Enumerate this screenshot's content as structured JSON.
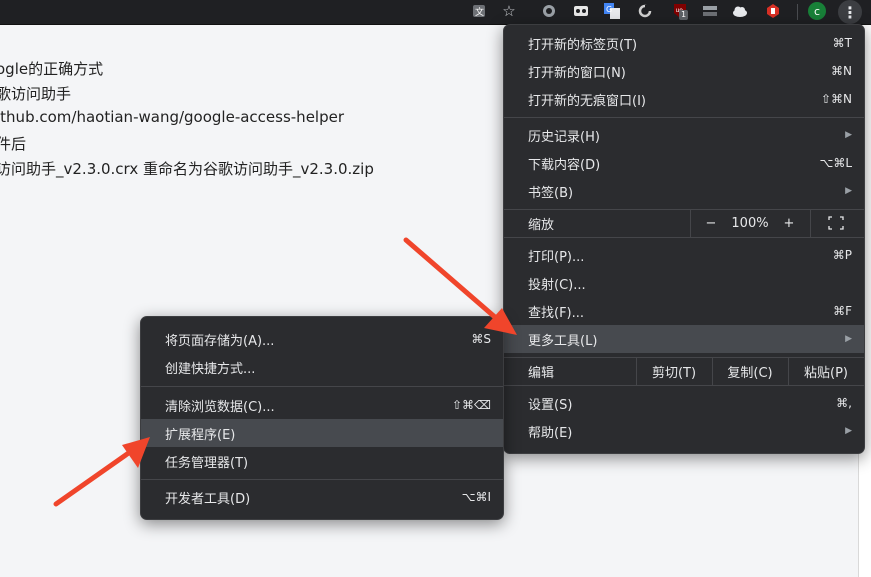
{
  "page": {
    "lines": [
      "ogle的正确方式",
      "歌访问助手",
      "ithub.com/haotian-wang/google-access-helper",
      "件后",
      "访问助手_v2.3.0.crx 重命名为谷歌访问助手_v2.3.0.zip"
    ]
  },
  "toolbar": {
    "badge_count": "1",
    "profile_letter": "c",
    "menu_glyph": "⋮",
    "star_glyph": "☆",
    "icons": [
      "translate-icon",
      "star-icon",
      "chrome-ext-icon",
      "ext-tape-icon",
      "google-translate-icon",
      "ext-cycle-icon",
      "ublock-icon",
      "ext-gray-icon",
      "cloud-icon",
      "ext-red-icon",
      "profile-icon",
      "more-menu-icon"
    ]
  },
  "main_menu": {
    "new_tab": {
      "label": "打开新的标签页(T)",
      "shortcut": "⌘T"
    },
    "new_window": {
      "label": "打开新的窗口(N)",
      "shortcut": "⌘N"
    },
    "incognito": {
      "label": "打开新的无痕窗口(I)",
      "shortcut": "⇧⌘N"
    },
    "history": {
      "label": "历史记录(H)"
    },
    "downloads": {
      "label": "下载内容(D)",
      "shortcut": "⌥⌘L"
    },
    "bookmarks": {
      "label": "书签(B)"
    },
    "zoom": {
      "label": "缩放",
      "minus": "−",
      "value": "100%",
      "plus": "+",
      "fullscreen": "⛶"
    },
    "print": {
      "label": "打印(P)...",
      "shortcut": "⌘P"
    },
    "cast": {
      "label": "投射(C)..."
    },
    "find": {
      "label": "查找(F)...",
      "shortcut": "⌘F"
    },
    "more_tools": {
      "label": "更多工具(L)"
    },
    "edit": {
      "label": "编辑",
      "cut": "剪切(T)",
      "copy": "复制(C)",
      "paste": "粘贴(P)"
    },
    "settings": {
      "label": "设置(S)",
      "shortcut": "⌘,"
    },
    "help": {
      "label": "帮助(E)"
    }
  },
  "sub_menu": {
    "save_page": {
      "label": "将页面存储为(A)...",
      "shortcut": "⌘S"
    },
    "create_shortcut": {
      "label": "创建快捷方式..."
    },
    "clear_data": {
      "label": "清除浏览数据(C)...",
      "shortcut": "⇧⌘⌫"
    },
    "extensions": {
      "label": "扩展程序(E)"
    },
    "task_manager": {
      "label": "任务管理器(T)"
    },
    "dev_tools": {
      "label": "开发者工具(D)",
      "shortcut": "⌥⌘I"
    }
  },
  "colors": {
    "menu_bg": "#2b2c2f",
    "menu_highlight": "#474a4f",
    "arrow_red": "#f0452b",
    "page_bg": "#f4f5f7"
  }
}
